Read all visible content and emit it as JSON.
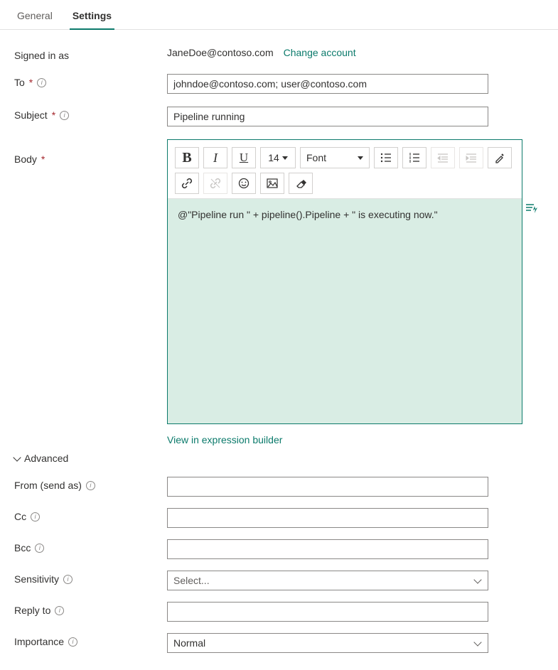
{
  "tabs": {
    "general": "General",
    "settings": "Settings"
  },
  "labels": {
    "signed_in_as": "Signed in as",
    "to": "To",
    "subject": "Subject",
    "body": "Body",
    "advanced": "Advanced",
    "from": "From (send as)",
    "cc": "Cc",
    "bcc": "Bcc",
    "sensitivity": "Sensitivity",
    "reply_to": "Reply to",
    "importance": "Importance"
  },
  "signed_in": {
    "email": "JaneDoe@contoso.com",
    "change": "Change account"
  },
  "fields": {
    "to": "johndoe@contoso.com; user@contoso.com",
    "subject": "Pipeline running",
    "body": "@\"Pipeline run \" + pipeline().Pipeline + \" is executing now.\"",
    "from": "",
    "cc": "",
    "bcc": "",
    "reply_to": ""
  },
  "sensitivity": {
    "placeholder": "Select..."
  },
  "importance": {
    "value": "Normal"
  },
  "toolbar": {
    "size": "14",
    "font": "Font"
  },
  "links": {
    "view_expr": "View in expression builder"
  }
}
